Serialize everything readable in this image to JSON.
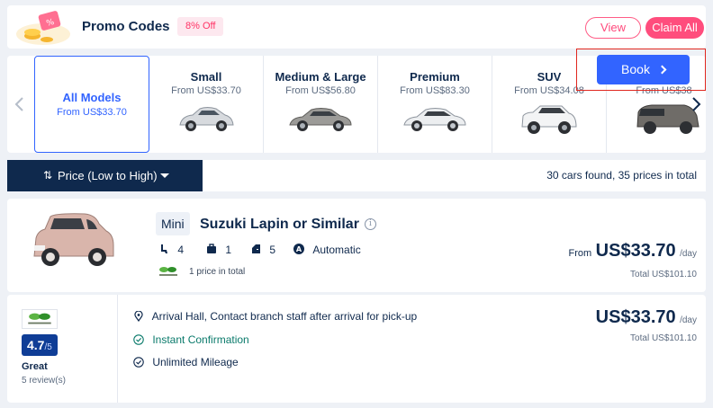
{
  "promo": {
    "title": "Promo Codes",
    "badge": "8% Off",
    "view_label": "View",
    "claim_label": "Claim All"
  },
  "models": [
    {
      "name": "All Models",
      "price": "From US$33.70",
      "selected": true
    },
    {
      "name": "Small",
      "price": "From US$33.70"
    },
    {
      "name": "Medium & Large",
      "price": "From US$56.80"
    },
    {
      "name": "Premium",
      "price": "From US$83.30"
    },
    {
      "name": "SUV",
      "price": "From US$34.08"
    },
    {
      "name": "Van",
      "price": "From US$38"
    }
  ],
  "sort": {
    "icon": "⇅",
    "label": "Price (Low to High)",
    "results": "30 cars found, 35 prices in total"
  },
  "car": {
    "class": "Mini",
    "name": "Suzuki Lapin or Similar",
    "seats": "4",
    "bags_small": "1",
    "doors": "5",
    "transmission": "Automatic",
    "price_count": "1 price in total",
    "from_label": "From",
    "from_price": "US$33.70",
    "per_day": "/day",
    "total": "Total US$101.10",
    "color": "#d9b5ab"
  },
  "offer": {
    "rating": "4.7",
    "rating_max": "/5",
    "rating_word": "Great",
    "reviews": "5 review(s)",
    "features": [
      "Arrival Hall, Contact branch staff after arrival for pick-up",
      "Instant Confirmation",
      "Unlimited Mileage"
    ],
    "price": "US$33.70",
    "per_day": "/day",
    "total": "Total US$101.10",
    "book_label": "Book"
  },
  "colors": {
    "accent": "#3264ff",
    "navy": "#0f294d",
    "promo_pink": "#ff4d7d",
    "highlight_red": "#e0271f"
  }
}
